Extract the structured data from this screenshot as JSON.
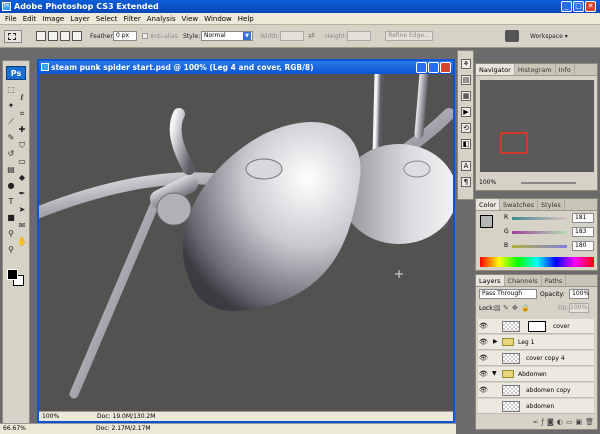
{
  "app": {
    "title": "Adobe Photoshop CS3 Extended",
    "icon_label": "Ps",
    "window_buttons": [
      "_",
      "□",
      "✕"
    ]
  },
  "menu": [
    "File",
    "Edit",
    "Image",
    "Layer",
    "Select",
    "Filter",
    "Analysis",
    "View",
    "Window",
    "Help"
  ],
  "options_bar": {
    "feather_label": "Feather:",
    "feather_value": "0 px",
    "anti_alias_label": "Anti-alias",
    "style_label": "Style:",
    "style_value": "Normal",
    "width_label": "Width:",
    "height_label": "Height:",
    "refine_edge_label": "Refine Edge...",
    "workspace_label": "Workspace ▾"
  },
  "toolbox": {
    "logo": "Ps",
    "tools": [
      "marquee-tool",
      "lasso-tool",
      "magic-wand-tool",
      "crop-tool",
      "slice-tool",
      "healing-tool",
      "brush-tool",
      "stamp-tool",
      "history-brush-tool",
      "eraser-tool",
      "gradient-tool",
      "blur-tool",
      "dodge-tool",
      "pen-tool",
      "type-tool",
      "path-select-tool",
      "shape-tool",
      "notes-tool",
      "eyedropper-tool",
      "hand-tool",
      "zoom-tool"
    ]
  },
  "document": {
    "title": "steam punk spider start.psd @ 100% (Leg 4 and cover, RGB/8)",
    "zoom": "100%",
    "doc_info": "Doc: 19.0M/130.2M"
  },
  "status": {
    "zoom": "66.67%",
    "doc_info": "Doc: 2.17M/2.17M"
  },
  "navigator_panel": {
    "tabs": [
      "Navigator",
      "Histogram",
      "Info"
    ],
    "zoom": "100%"
  },
  "color_panel": {
    "tabs": [
      "Color",
      "Swatches",
      "Styles"
    ],
    "channels": [
      {
        "label": "R",
        "value": "181"
      },
      {
        "label": "G",
        "value": "183"
      },
      {
        "label": "B",
        "value": "180"
      }
    ],
    "foreground_hex": "#b5b7b4"
  },
  "layers_panel": {
    "tabs": [
      "Layers",
      "Channels",
      "Paths"
    ],
    "blend_mode": "Pass Through",
    "opacity_label": "Opacity:",
    "opacity_value": "100%",
    "lock_label": "Lock:",
    "fill_label": "Fill:",
    "fill_value": "100%",
    "layers": [
      {
        "name": "cover",
        "kind": "masked"
      },
      {
        "name": "Leg 1",
        "kind": "group"
      },
      {
        "name": "cover copy 4",
        "kind": "layer"
      },
      {
        "name": "Abdomen",
        "kind": "group-open"
      },
      {
        "name": "abdomen copy",
        "kind": "layer"
      },
      {
        "name": "abdomen",
        "kind": "layer"
      }
    ]
  }
}
